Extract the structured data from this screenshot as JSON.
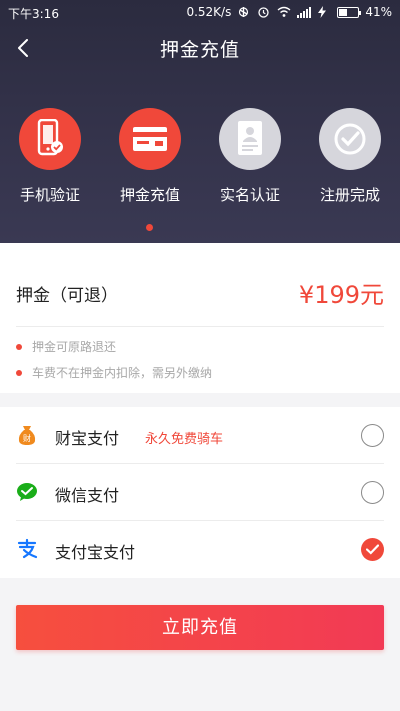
{
  "status_bar": {
    "time": "下午3:16",
    "network_speed": "0.52K/s",
    "battery": "41%"
  },
  "header": {
    "title": "押金充值",
    "back_icon": "chevron-left-icon"
  },
  "steps": [
    {
      "label": "手机验证",
      "icon": "phone-check-icon",
      "state": "active"
    },
    {
      "label": "押金充值",
      "icon": "card-icon",
      "state": "active"
    },
    {
      "label": "实名认证",
      "icon": "id-card-icon",
      "state": "inactive"
    },
    {
      "label": "注册完成",
      "icon": "checkmark-circle-icon",
      "state": "inactive"
    }
  ],
  "deposit": {
    "label": "押金（可退）",
    "amount": "¥199元",
    "notes": [
      "押金可原路退还",
      "车费不在押金内扣除，需另外缴纳"
    ]
  },
  "payments": [
    {
      "name": "财宝支付",
      "promo": "永久免费骑车",
      "icon": "money-bag-icon",
      "selected": false
    },
    {
      "name": "微信支付",
      "promo": "",
      "icon": "wechat-icon",
      "selected": false
    },
    {
      "name": "支付宝支付",
      "promo": "",
      "icon": "alipay-icon",
      "selected": true
    }
  ],
  "submit_label": "立即充值",
  "colors": {
    "accent": "#f0483a",
    "header_bg": "#2f2e44",
    "wechat": "#1aad19",
    "alipay": "#1677ff",
    "money_bag": "#f08a1e"
  }
}
